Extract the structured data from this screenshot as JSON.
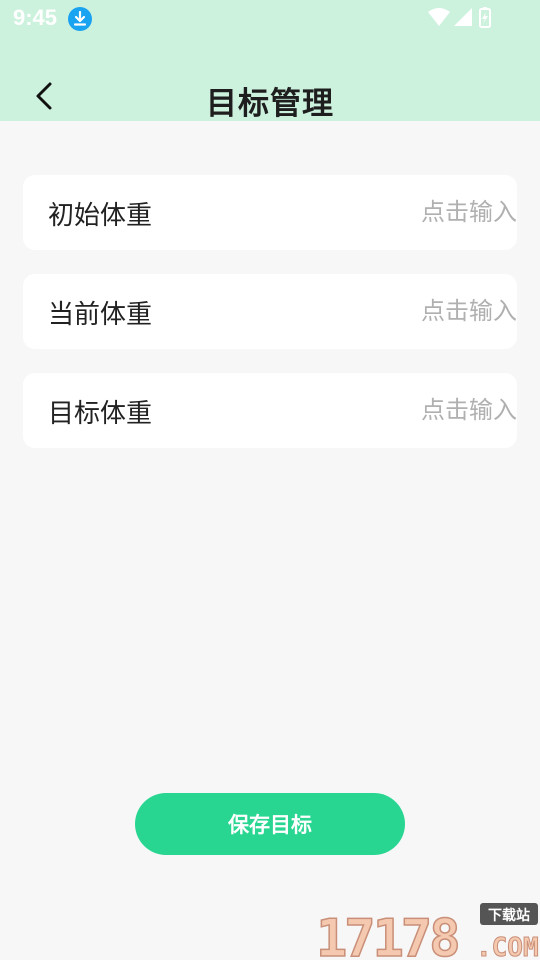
{
  "status_bar": {
    "time": "9:45"
  },
  "header": {
    "title": "目标管理"
  },
  "form": {
    "fields": [
      {
        "label": "初始体重",
        "placeholder": "点击输入"
      },
      {
        "label": "当前体重",
        "placeholder": "点击输入"
      },
      {
        "label": "目标体重",
        "placeholder": "点击输入"
      }
    ]
  },
  "actions": {
    "save_label": "保存目标"
  },
  "watermark": {
    "number": "17178",
    "tag": "下载站",
    "domain": ".COM"
  },
  "colors": {
    "header_bg": "#ccf2de",
    "accent": "#28d691",
    "page_bg": "#f7f7f7"
  }
}
